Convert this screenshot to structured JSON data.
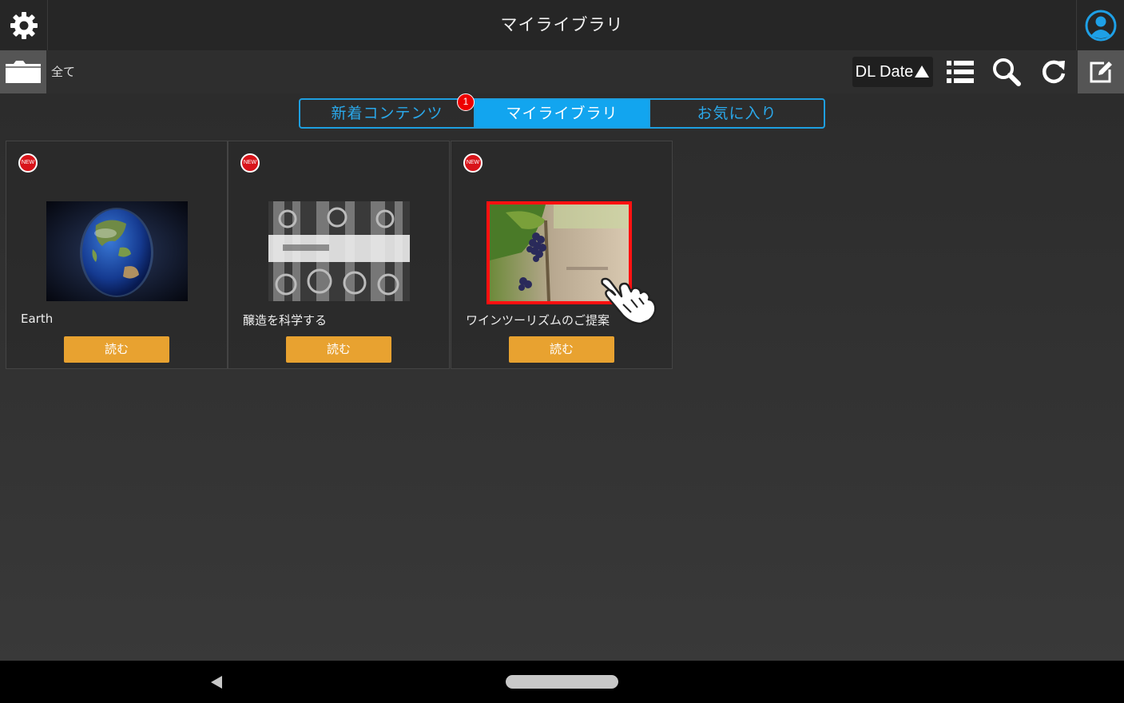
{
  "app": {
    "title": "マイライブラリ"
  },
  "toolbar": {
    "filter_label": "全て",
    "sort_label": "DL Date"
  },
  "tabs": [
    {
      "label": "新着コンテンツ",
      "badge": "1"
    },
    {
      "label": "マイライブラリ",
      "active": true
    },
    {
      "label": "お気に入り"
    }
  ],
  "cards": [
    {
      "badge": "NEW",
      "title": "Earth",
      "button": "読む"
    },
    {
      "badge": "NEW",
      "title": "醸造を科学する",
      "button": "読む"
    },
    {
      "badge": "NEW",
      "title": "ワインツーリズムのご提案",
      "button": "読む"
    }
  ],
  "colors": {
    "accent": "#12a5ef",
    "button": "#e8a230",
    "badge": "#d8141a",
    "highlight": "#ff1010"
  }
}
